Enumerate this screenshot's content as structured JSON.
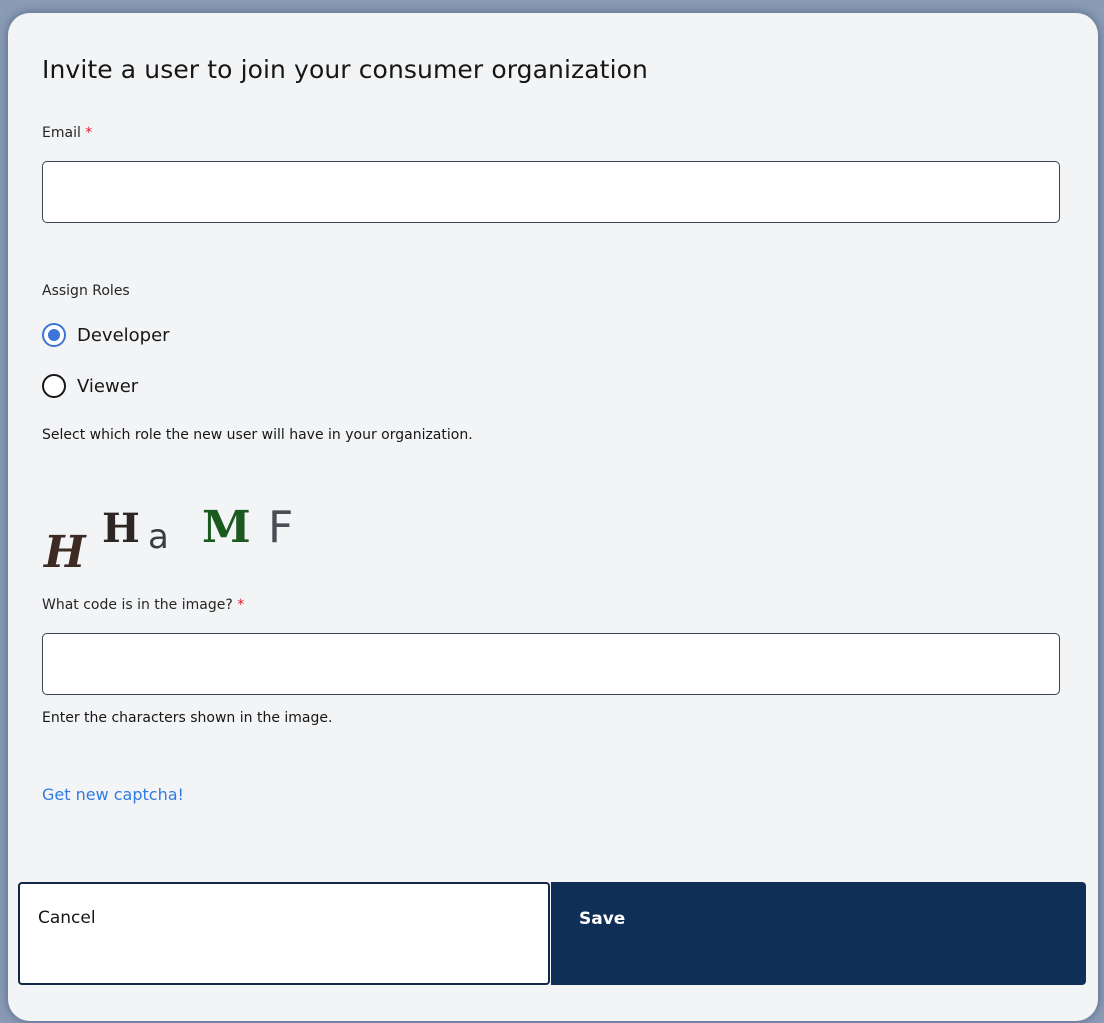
{
  "dialog": {
    "title": "Invite a user to join your consumer organization"
  },
  "email": {
    "label": "Email",
    "required_mark": "*",
    "value": "",
    "placeholder": ""
  },
  "roles": {
    "label": "Assign Roles",
    "options": [
      {
        "label": "Developer",
        "selected": true
      },
      {
        "label": "Viewer",
        "selected": false
      }
    ],
    "helper": "Select which role the new user will have in your organization."
  },
  "captcha": {
    "image_text": "HHaMF",
    "label": "What code is in the image?",
    "required_mark": "*",
    "value": "",
    "placeholder": "",
    "helper": "Enter the characters shown in the image.",
    "refresh_link": "Get new captcha!"
  },
  "actions": {
    "cancel_label": "Cancel",
    "save_label": "Save"
  },
  "colors": {
    "primary": "#0f2f56",
    "accent": "#3d74d8",
    "link": "#2f7be3",
    "required": "#da1e28"
  }
}
